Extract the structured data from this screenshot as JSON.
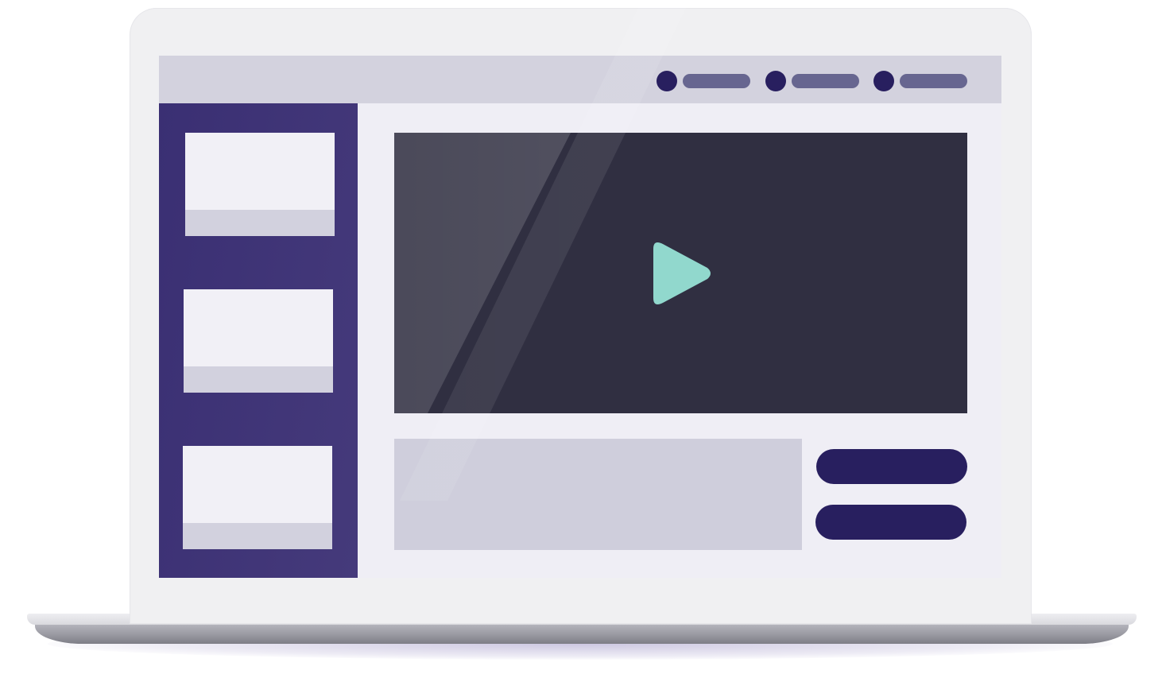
{
  "colors": {
    "sidebar": "#3f3478",
    "topbar": "#d3d2de",
    "screen_bg": "#efeef5",
    "nav_dot": "#281f5f",
    "nav_pill": "#676690",
    "video_bg": "#302f41",
    "play_accent": "#91d8cd",
    "button": "#281f5f",
    "placeholder": "#cfcedc"
  },
  "nav": {
    "items": [
      {
        "icon": "dot-icon",
        "label": ""
      },
      {
        "icon": "dot-icon",
        "label": ""
      },
      {
        "icon": "dot-icon",
        "label": ""
      }
    ]
  },
  "sidebar": {
    "thumbnails": [
      {
        "caption": ""
      },
      {
        "caption": ""
      },
      {
        "caption": ""
      }
    ]
  },
  "video": {
    "play_icon": "play-icon"
  },
  "description": {
    "text": ""
  },
  "actions": {
    "primary_label": "",
    "secondary_label": ""
  }
}
